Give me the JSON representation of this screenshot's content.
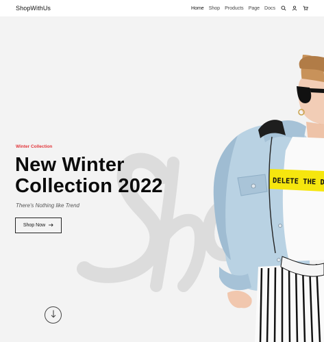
{
  "header": {
    "brand": "ShopWithUs",
    "nav": [
      {
        "label": "Home",
        "active": true
      },
      {
        "label": "Shop",
        "active": false
      },
      {
        "label": "Products",
        "active": false
      },
      {
        "label": "Page",
        "active": false
      },
      {
        "label": "Docs",
        "active": false
      }
    ],
    "icons": [
      "search-icon",
      "user-icon",
      "cart-icon"
    ]
  },
  "hero": {
    "eyebrow": "Winter Collection",
    "title_line1": "New Winter",
    "title_line2": "Collection 2022",
    "tagline": "There's Nothing like Trend",
    "button_label": "Shop Now",
    "watermark": "Sho",
    "shirt_text": "DELETE THE DRA",
    "scroll_icon": "arrow-down-icon"
  },
  "colors": {
    "accent": "#e2353a",
    "text": "#0b0b0b",
    "background": "#f3f3f3",
    "shirt_band": "#f6e60e"
  }
}
